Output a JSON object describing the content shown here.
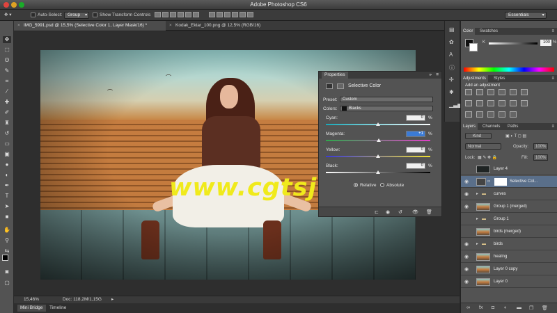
{
  "app": {
    "title": "Adobe Photoshop CS6",
    "workspace": "Essentials"
  },
  "options_bar": {
    "auto_select_label": "Auto-Select:",
    "auto_select_value": "Group",
    "show_transform_label": "Show Transform Controls"
  },
  "doc_tabs": [
    {
      "label": "IMG_5991.psd @ 15,5% (Selective Color 1, Layer Mask/16) *",
      "active": true
    },
    {
      "label": "Kodak_Ektar_100.png @ 12,5% (RGB/16)",
      "active": false
    }
  ],
  "watermark": "www.cgtsj.com",
  "status": {
    "zoom": "15,46%",
    "doc_info": "Doc: 118,2M/1,15G"
  },
  "bottom_tabs": [
    "Mini Bridge",
    "Timeline"
  ],
  "properties": {
    "panel_title": "Properties",
    "adjustment_name": "Selective Color",
    "preset_label": "Preset:",
    "preset_value": "Custom",
    "colors_label": "Colors:",
    "colors_value": "Blacks",
    "sliders": [
      {
        "label": "Cyan:",
        "value": "0",
        "unit": "%",
        "level": 0.5
      },
      {
        "label": "Magenta:",
        "value": "+1",
        "unit": "%",
        "level": 0.505
      },
      {
        "label": "Yellow:",
        "value": "0",
        "unit": "%",
        "level": 0.5
      },
      {
        "label": "Black:",
        "value": "0",
        "unit": "%",
        "level": 0.5
      }
    ],
    "method_relative": "Relative",
    "method_absolute": "Absolute",
    "method_selected": "Relative"
  },
  "color_panel": {
    "tabs": [
      "Color",
      "Swatches"
    ],
    "channel": "K",
    "value": "100",
    "unit": "%"
  },
  "adjustments_panel": {
    "tabs": [
      "Adjustments",
      "Styles"
    ],
    "hint": "Add an adjustment"
  },
  "layers_panel": {
    "tabs": [
      "Layers",
      "Channels",
      "Paths"
    ],
    "filter_value": "Kind",
    "blend_mode": "Normal",
    "opacity_label": "Opacity:",
    "opacity_value": "100%",
    "lock_label": "Lock:",
    "fill_label": "Fill:",
    "fill_value": "100%",
    "layers": [
      {
        "name": "Layer 4",
        "type": "layer",
        "visible": false,
        "selected": false
      },
      {
        "name": "Selective Col...",
        "type": "adjustment",
        "visible": true,
        "selected": true
      },
      {
        "name": "curves",
        "type": "group",
        "visible": true,
        "selected": false
      },
      {
        "name": "Group 1 (merged)",
        "type": "layer",
        "visible": true,
        "selected": false
      },
      {
        "name": "Group 1",
        "type": "group",
        "visible": false,
        "selected": false
      },
      {
        "name": "birds (merged)",
        "type": "layer",
        "visible": false,
        "selected": false
      },
      {
        "name": "birds",
        "type": "group",
        "visible": true,
        "selected": false
      },
      {
        "name": "healing",
        "type": "layer",
        "visible": true,
        "selected": false
      },
      {
        "name": "Layer 0 copy",
        "type": "layer",
        "visible": true,
        "selected": false
      },
      {
        "name": "Layer 0",
        "type": "layer",
        "visible": true,
        "selected": false
      }
    ]
  },
  "colors": {
    "accent_selection": "#3b7bd6",
    "watermark": "#f0ea1b",
    "folder": "#d9c28a"
  }
}
